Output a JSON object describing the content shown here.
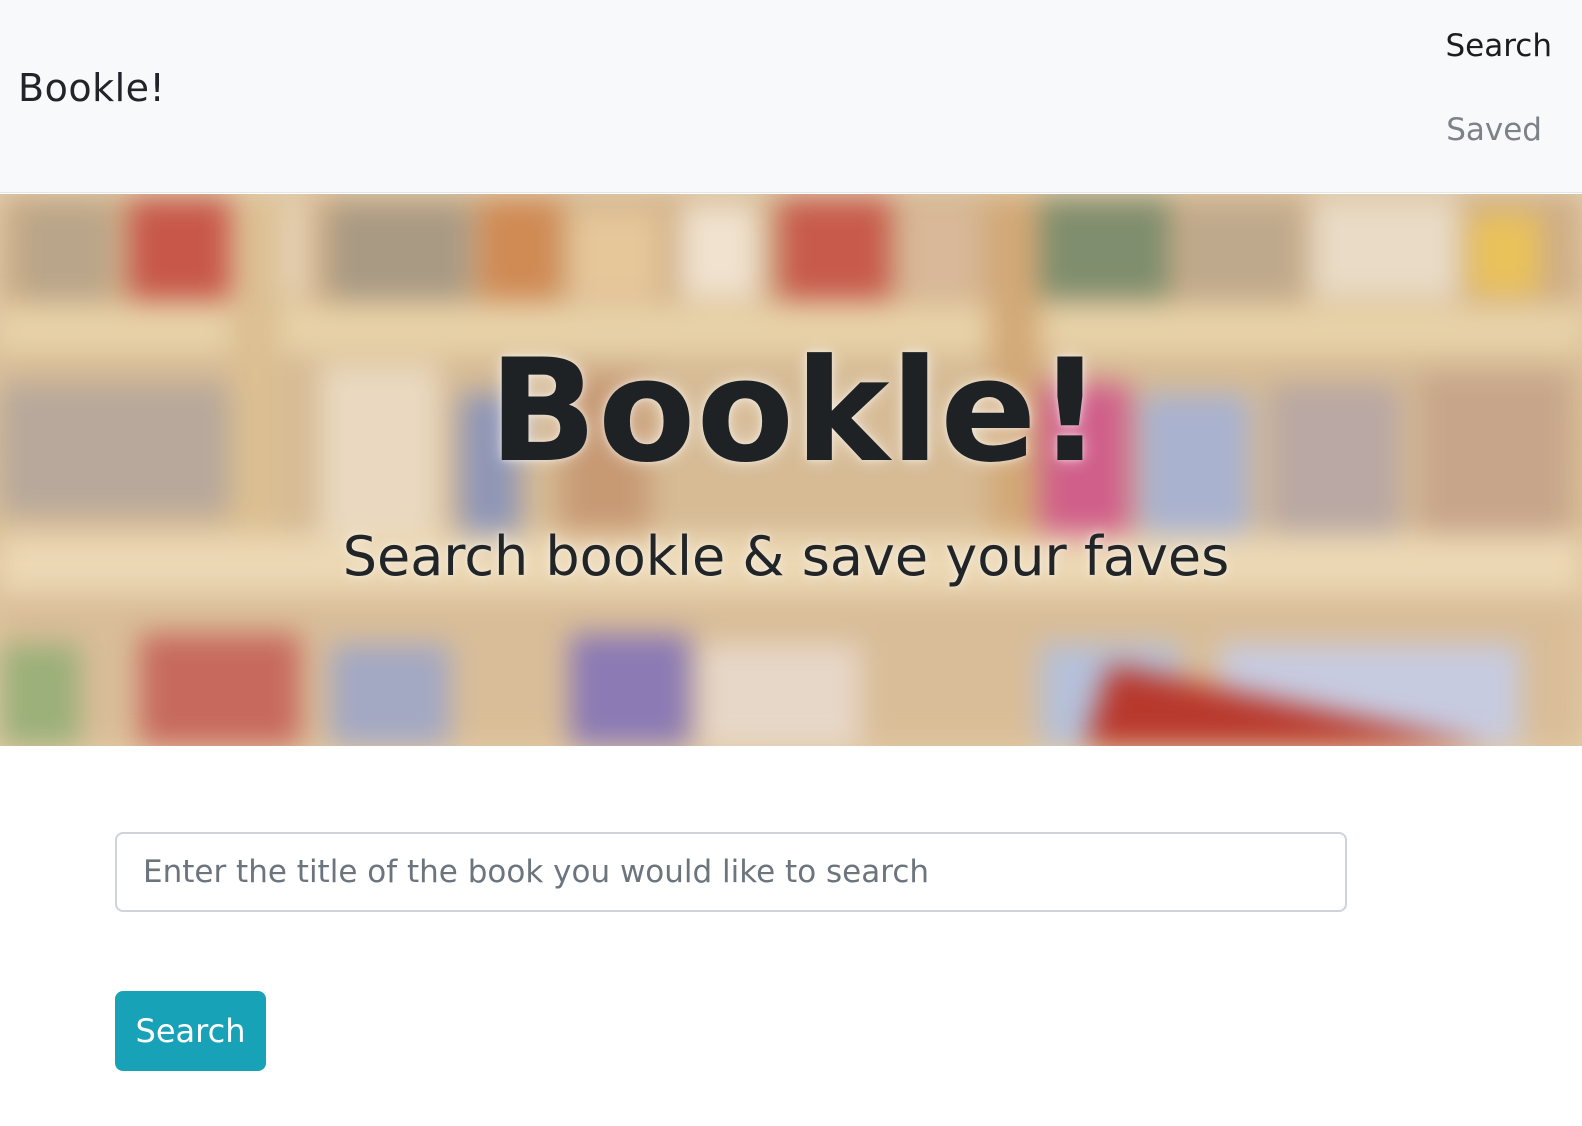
{
  "navbar": {
    "brand": "Bookle!",
    "links": [
      {
        "label": "Search",
        "active": true
      },
      {
        "label": "Saved",
        "active": false
      }
    ]
  },
  "hero": {
    "title": "Bookle!",
    "subtitle": "Search bookle & save your faves"
  },
  "search": {
    "placeholder": "Enter the title of the book you would like to search",
    "value": "",
    "button_label": "Search"
  },
  "colors": {
    "navbar_bg": "#f8f9fa",
    "button_bg": "#17a2b8",
    "text_dark": "#212529",
    "text_muted": "#7d8288"
  }
}
